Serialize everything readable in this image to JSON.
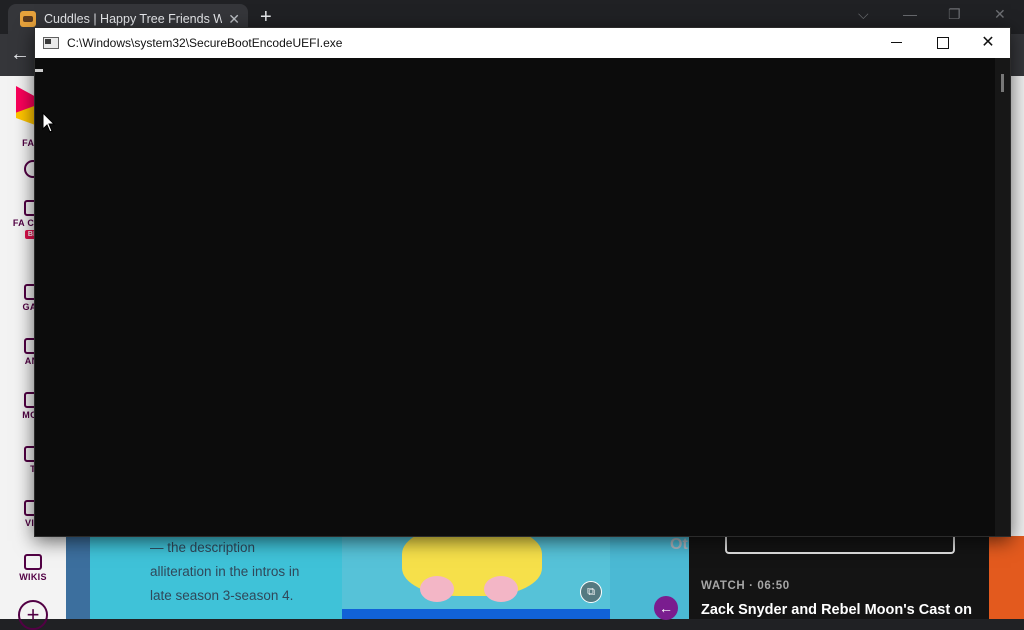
{
  "browser": {
    "tab_title": "Cuddles | Happy Tree Friends Wil",
    "tab_close": "✕",
    "new_tab": "+",
    "window_controls": {
      "tabs_menu": "⌵",
      "minimize": "—",
      "restore": "❐",
      "close": "✕"
    },
    "back": "←"
  },
  "console": {
    "title": "C:\\Windows\\system32\\SecureBootEncodeUEFI.exe",
    "close_glyph": "✕"
  },
  "fandom_rail": {
    "items": [
      {
        "label": "FANI"
      },
      {
        "label": "FA CENT",
        "badge": "BE"
      },
      {
        "label": "GAN"
      },
      {
        "label": "ANI"
      },
      {
        "label": "MOV"
      },
      {
        "label": "T"
      },
      {
        "label": "VID"
      },
      {
        "label": "WIKIS"
      }
    ],
    "plus": "+"
  },
  "page": {
    "infocard_lines": [
      "— the description",
      "alliteration in the intros in",
      "late season 3-season 4."
    ],
    "side_tag": "Ot",
    "arrow": "←",
    "video": {
      "meta": "WATCH · 06:50",
      "title": "Zack Snyder and Rebel Moon's Cast on"
    },
    "expand": "⧉"
  }
}
